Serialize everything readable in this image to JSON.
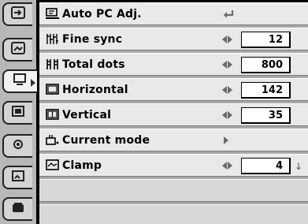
{
  "sidebar": {
    "tabs": [
      {
        "icon": "input-icon",
        "active": false
      },
      {
        "icon": "picture-adjust-icon",
        "active": false
      },
      {
        "icon": "pc-adjust-icon",
        "active": true
      },
      {
        "icon": "screen-icon",
        "active": false
      },
      {
        "icon": "setting-icon",
        "active": false
      },
      {
        "icon": "image-select-icon",
        "active": false
      },
      {
        "icon": "sound-icon",
        "active": false
      }
    ]
  },
  "menu": {
    "items": [
      {
        "label": "Auto PC Adj.",
        "icon": "auto-pc-adj-icon",
        "control": "enter",
        "value": ""
      },
      {
        "label": "Fine sync",
        "icon": "fine-sync-icon",
        "control": "left-right",
        "value": "12"
      },
      {
        "label": "Total dots",
        "icon": "total-dots-icon",
        "control": "left-right",
        "value": "800"
      },
      {
        "label": "Horizontal",
        "icon": "horizontal-icon",
        "control": "left-right",
        "value": "142"
      },
      {
        "label": "Vertical",
        "icon": "vertical-icon",
        "control": "left-right",
        "value": "35"
      },
      {
        "label": "Current mode",
        "icon": "current-mode-icon",
        "control": "right",
        "value": ""
      },
      {
        "label": "Clamp",
        "icon": "clamp-icon",
        "control": "left-right",
        "value": "4"
      }
    ],
    "more_indicator": "↓"
  }
}
